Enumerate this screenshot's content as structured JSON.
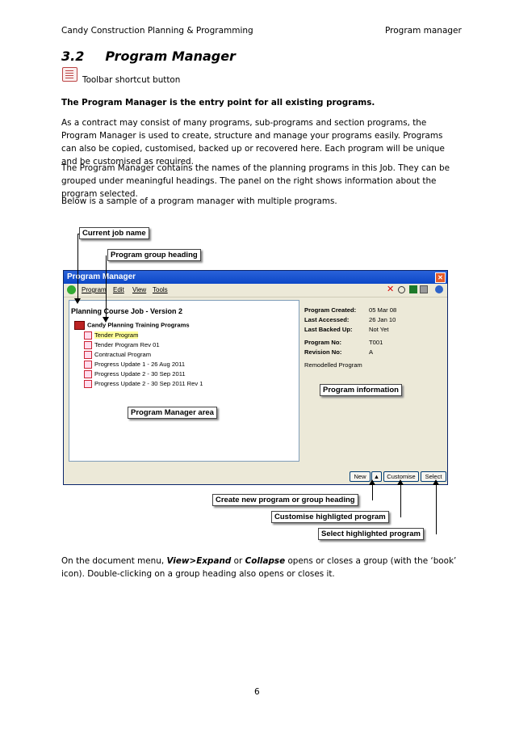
{
  "header": {
    "left": "Candy Construction Planning & Programming",
    "right": "Program manager"
  },
  "section": {
    "number": "3.2",
    "title": "Program Manager"
  },
  "toolbar_note": "Toolbar shortcut button",
  "lead": "The Program Manager is the entry point for all existing programs.",
  "para1": "As a contract may consist of many programs, sub-programs and section programs, the Program Manager is used to create, structure and manage your programs easily. Programs can also be copied, customised, backed up or recovered here. Each program will be unique and be customised as required.",
  "para2": "The Program Manager contains the names of the planning programs in this Job. They can be grouped under meaningful headings. The panel on the right shows information about the program selected.",
  "para3": "Below is a sample of a program manager with multiple programs.",
  "window": {
    "title": "Program Manager",
    "close": "✕",
    "menus": [
      "Program",
      "Edit",
      "View",
      "Tools"
    ],
    "job_line": "Planning Course Job - Version 2",
    "group": "Candy Planning Training Programs",
    "programs": [
      "Tender Program",
      "Tender Program Rev 01",
      "Contractual Program",
      "Progress Update 1 - 26 Aug 2011",
      "Progress Update 2 - 30 Sep 2011",
      "Progress Update 2 - 30 Sep 2011 Rev 1"
    ],
    "info": {
      "created_label": "Program Created:",
      "created_value": "05 Mar 08",
      "accessed_label": "Last Accessed:",
      "accessed_value": "26 Jan 10",
      "backed_label": "Last Backed Up:",
      "backed_value": "Not Yet",
      "no_label": "Program No:",
      "no_value": "T001",
      "rev_label": "Revision No:",
      "rev_value": "A",
      "note": "Remodelled Program"
    },
    "buttons": {
      "new": "New",
      "up": "▲",
      "customise": "Customise",
      "select": "Select"
    }
  },
  "callouts": {
    "job_name": "Current job name",
    "group_heading": "Program group heading",
    "info": "Program information",
    "area": "Program Manager area",
    "create": "Create new program or group heading",
    "customise": "Customise highligted program",
    "select": "Select highlighted program"
  },
  "footer": {
    "pre": "On the document menu, ",
    "expand": "View>Expand",
    "or": " or ",
    "collapse": "Collapse",
    "post": " opens or closes a group (with the ‘book’ icon). Double-clicking on a group heading also opens or closes it."
  },
  "page_number": "6"
}
